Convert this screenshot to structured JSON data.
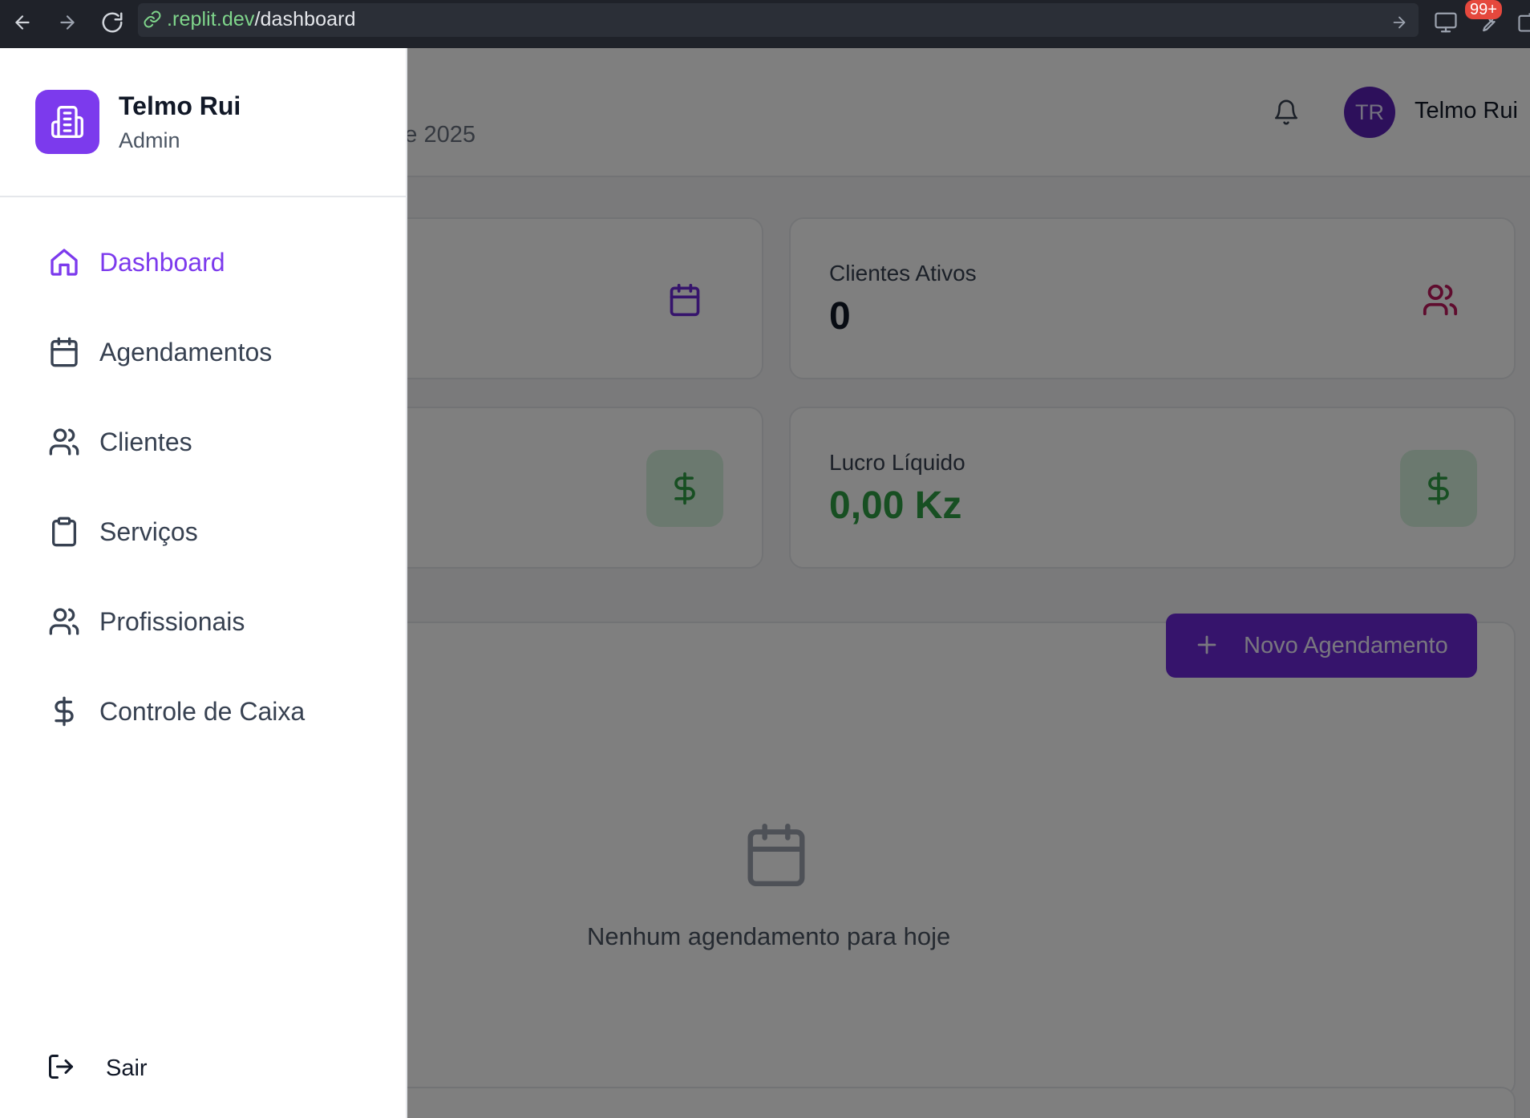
{
  "browser": {
    "url_host": ".replit.dev",
    "url_path": "/dashboard",
    "notification_badge": "99+"
  },
  "header": {
    "subtitle_partial": "e 2025",
    "user_initials": "TR",
    "user_name": "Telmo Rui"
  },
  "stats": {
    "clientes_label": "Clientes Ativos",
    "clientes_value": "0",
    "lucro_label": "Lucro Líquido",
    "lucro_value": "0,00 Kz"
  },
  "appointments": {
    "new_button": "Novo Agendamento",
    "empty_text": "Nenhum agendamento para hoje"
  },
  "sidebar": {
    "user_name": "Telmo Rui",
    "role": "Admin",
    "items": [
      {
        "label": "Dashboard",
        "icon": "home-icon",
        "active": true
      },
      {
        "label": "Agendamentos",
        "icon": "calendar-icon",
        "active": false
      },
      {
        "label": "Clientes",
        "icon": "users-icon",
        "active": false
      },
      {
        "label": "Serviços",
        "icon": "clipboard-icon",
        "active": false
      },
      {
        "label": "Profissionais",
        "icon": "users-icon",
        "active": false
      },
      {
        "label": "Controle de Caixa",
        "icon": "dollar-icon",
        "active": false
      }
    ],
    "logout": "Sair"
  },
  "colors": {
    "accent": "#7c3aed",
    "primary_button": "#6d28d9",
    "success": "#2f9e44",
    "overlay": "rgba(0,0,0,0.5)"
  }
}
